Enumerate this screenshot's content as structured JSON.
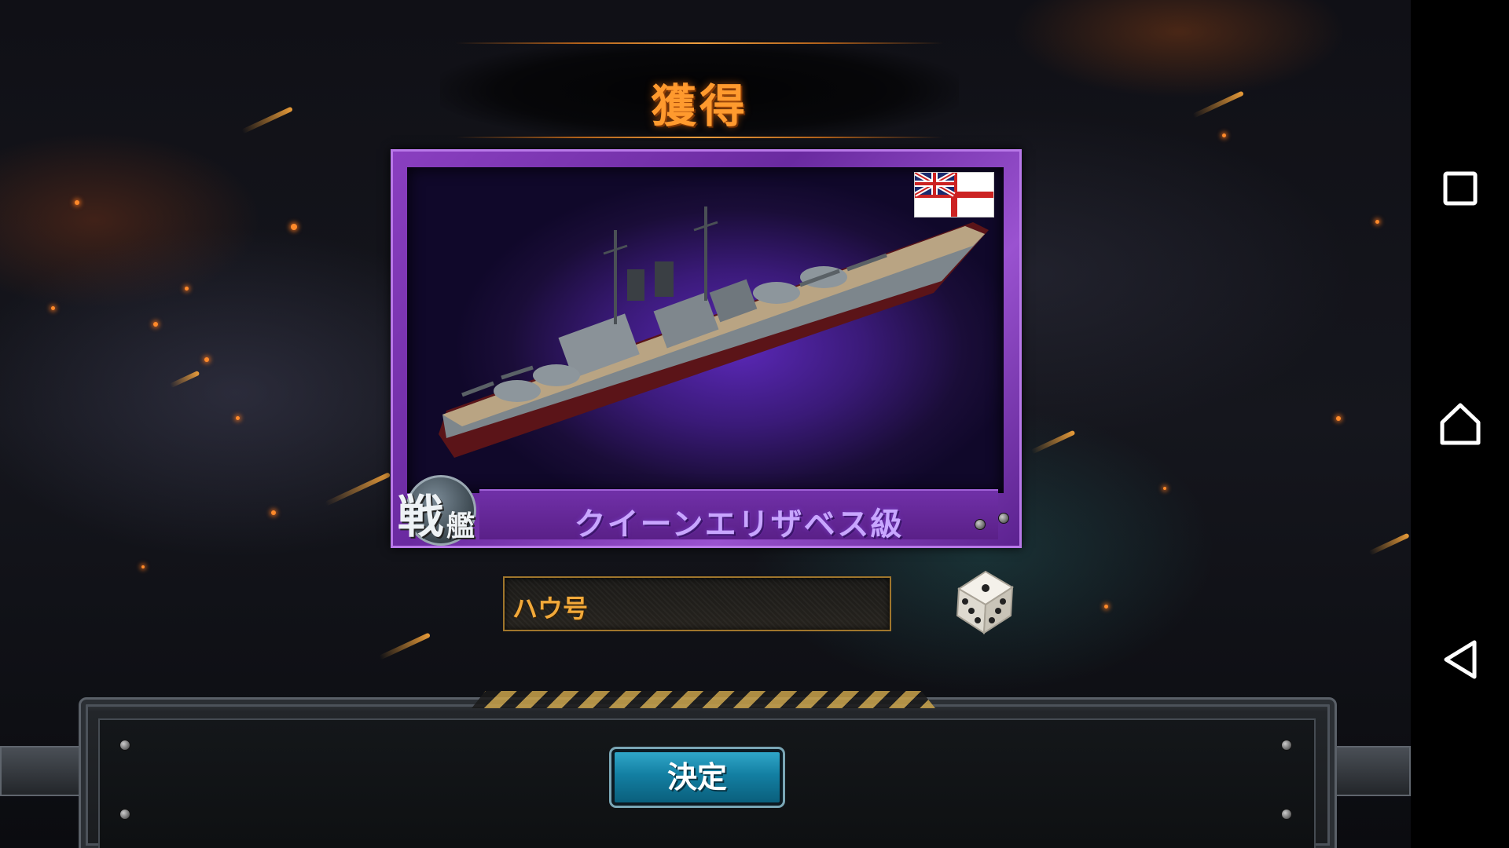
{
  "header": {
    "title": "獲得"
  },
  "ship_card": {
    "flag_icon": "royal-navy-white-ensign-icon",
    "ship_type_badge": {
      "large_char": "戦",
      "small_char": "艦"
    },
    "class_name": "クイーンエリザベス級",
    "rarity_color": "#8a3fc0"
  },
  "name_field": {
    "value": "ハウ号",
    "random_name_icon": "dice-icon"
  },
  "footer": {
    "confirm_label": "決定",
    "button_color": "#137fa2"
  },
  "system_nav": {
    "recents_icon": "square-recents-icon",
    "home_icon": "home-icon",
    "back_icon": "triangle-back-icon"
  }
}
